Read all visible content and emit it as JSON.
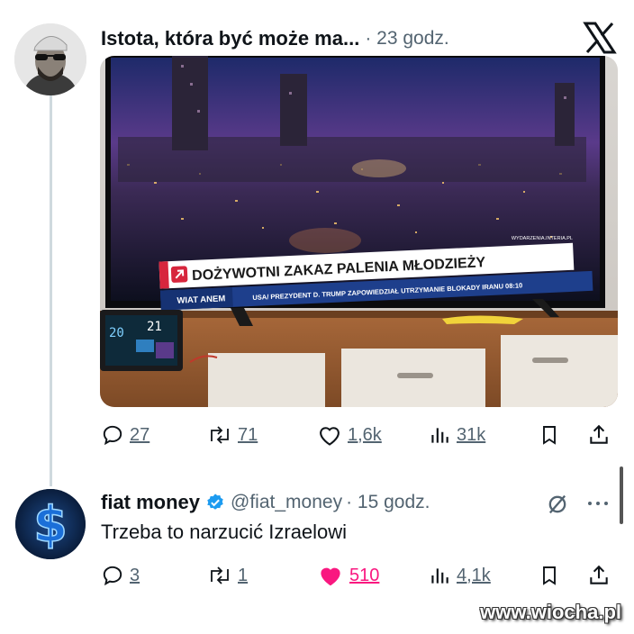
{
  "tweet1": {
    "author_name": "Istota, która być może ma...",
    "timestamp": "· 23 godz.",
    "media": {
      "tv_headline": "DOŻYWOTNI ZAKAZ PALENIA MŁODZIEŻY",
      "tv_ticker_left": "WIAT ANEM",
      "tv_ticker": "USA/ PREZYDENT D. TRUMP ZAPOWIEDZIAŁ UTRZYMANIE BLOKADY IRANU 08:10",
      "tv_source": "WYDARZENIA.INTERIA.PL"
    },
    "actions": {
      "replies": "27",
      "reposts": "71",
      "likes": "1,6k",
      "views": "31k"
    }
  },
  "tweet2": {
    "author_name": "fiat money",
    "handle": "@fiat_money",
    "timestamp": "· 15 godz.",
    "text": "Trzeba to narzucić Izraelowi",
    "actions": {
      "replies": "3",
      "reposts": "1",
      "likes": "510",
      "views": "4,1k"
    }
  },
  "colors": {
    "text": "#0f1419",
    "secondary": "#536471",
    "like_pink": "#f91880",
    "verified_blue": "#1d9bf0",
    "tv_red": "#d7263d"
  },
  "watermark": "www.wiocha.pl"
}
